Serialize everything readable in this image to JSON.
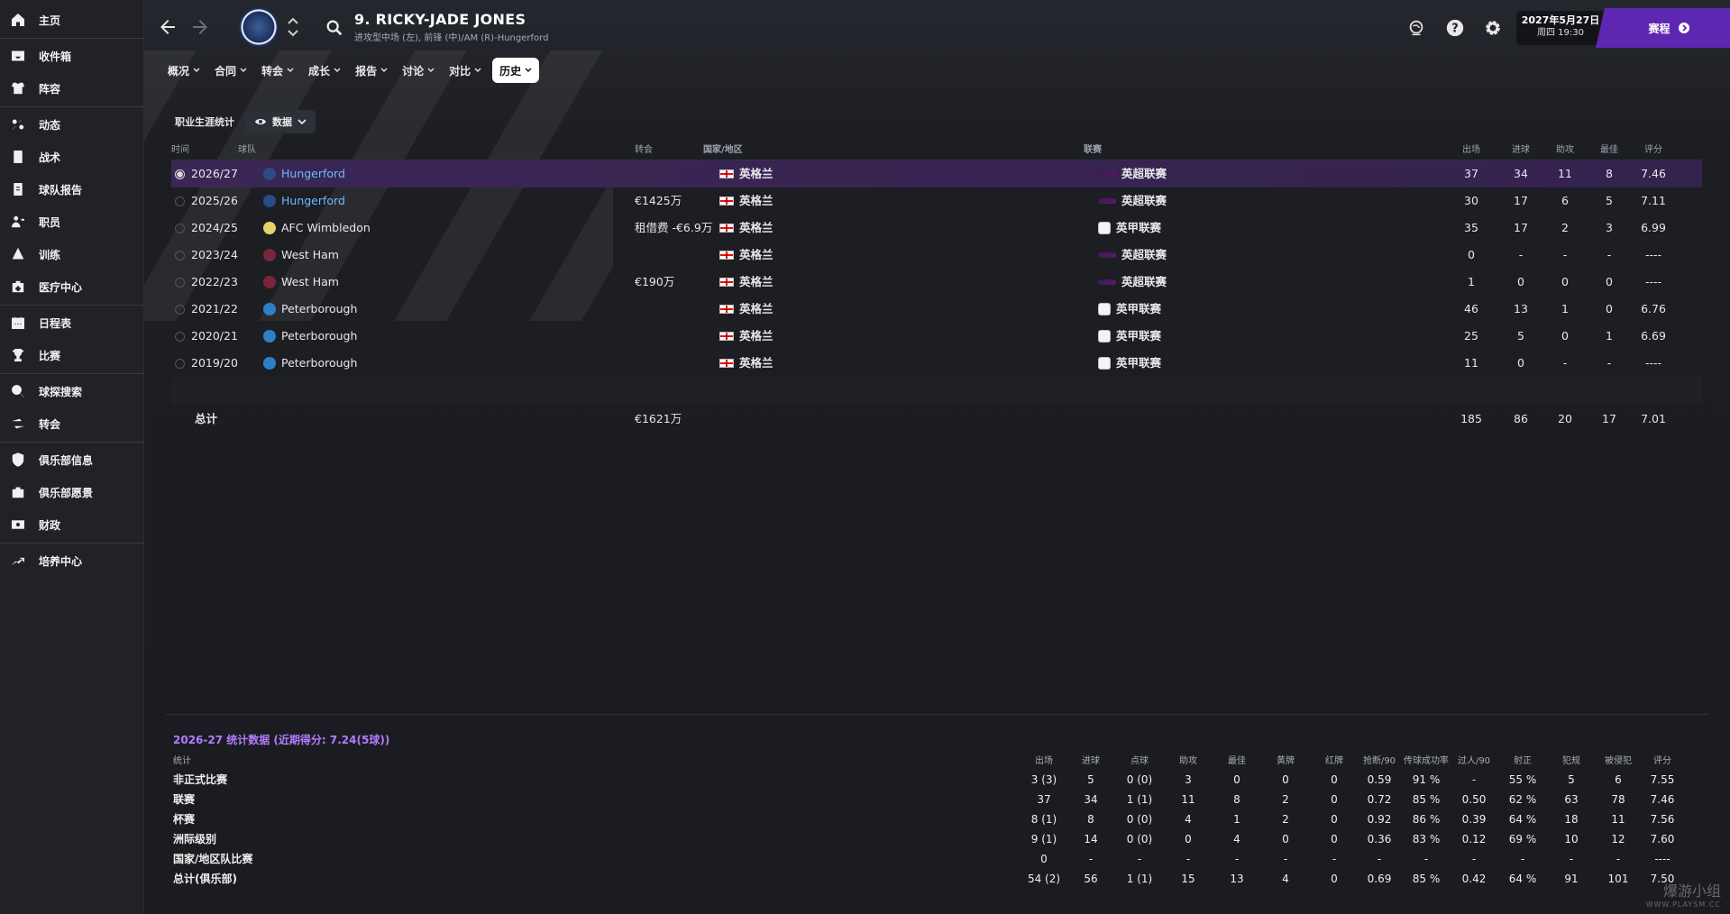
{
  "sidebar": {
    "items": [
      {
        "label": "主页",
        "icon": "home-icon"
      },
      {
        "label": "收件箱",
        "icon": "inbox-icon"
      },
      {
        "label": "阵容",
        "icon": "squad-icon"
      },
      {
        "label": "动态",
        "icon": "dynamics-icon"
      },
      {
        "label": "战术",
        "icon": "tactics-icon"
      },
      {
        "label": "球队报告",
        "icon": "team-report-icon"
      },
      {
        "label": "职员",
        "icon": "staff-icon"
      },
      {
        "label": "训练",
        "icon": "training-icon"
      },
      {
        "label": "医疗中心",
        "icon": "medical-icon"
      },
      {
        "label": "日程表",
        "icon": "schedule-icon"
      },
      {
        "label": "比赛",
        "icon": "trophy-icon"
      },
      {
        "label": "球探搜索",
        "icon": "scouting-icon"
      },
      {
        "label": "转会",
        "icon": "transfer-icon"
      },
      {
        "label": "俱乐部信息",
        "icon": "club-info-icon"
      },
      {
        "label": "俱乐部愿景",
        "icon": "club-vision-icon"
      },
      {
        "label": "财政",
        "icon": "finance-icon"
      },
      {
        "label": "培养中心",
        "icon": "development-icon"
      }
    ]
  },
  "header": {
    "player_name": "9. RICKY-JADE JONES",
    "player_sub": "进攻型中场 (左), 前锋 (中)/AM (R)-Hungerford",
    "date": "2027年5月27日",
    "date_sub": "周四 19:30",
    "continue_label": "赛程"
  },
  "tabs": [
    {
      "label": "概况"
    },
    {
      "label": "合同"
    },
    {
      "label": "转会"
    },
    {
      "label": "成长"
    },
    {
      "label": "报告"
    },
    {
      "label": "讨论"
    },
    {
      "label": "对比"
    },
    {
      "label": "历史",
      "active": true
    }
  ],
  "subheader": {
    "label": "职业生涯统计",
    "data_button": "数据"
  },
  "career": {
    "headers": {
      "year": "时间",
      "team": "球队",
      "fee": "转会",
      "nation": "国家/地区",
      "league": "联赛",
      "apps": "出场",
      "goals": "进球",
      "assists": "助攻",
      "pom": "最佳",
      "rating": "评分"
    },
    "rows": [
      {
        "year": "2026/27",
        "team": "Hungerford",
        "team_color": "#2b4a86",
        "link": true,
        "fee": "",
        "nation": "英格兰",
        "league": "英超联赛",
        "league_type": "pl",
        "apps": "37",
        "goals": "34",
        "assists": "11",
        "pom": "8",
        "rating": "7.46",
        "selected": true
      },
      {
        "year": "2025/26",
        "team": "Hungerford",
        "team_color": "#2b4a86",
        "link": true,
        "fee": "€1425万",
        "nation": "英格兰",
        "league": "英超联赛",
        "league_type": "pl",
        "apps": "30",
        "goals": "17",
        "assists": "6",
        "pom": "5",
        "rating": "7.11"
      },
      {
        "year": "2024/25",
        "team": "AFC Wimbledon",
        "team_color": "#e8d36a",
        "link": false,
        "fee": "租借费 -€6.9万",
        "nation": "英格兰",
        "league": "英甲联赛",
        "league_type": "efl",
        "apps": "35",
        "goals": "17",
        "assists": "2",
        "pom": "3",
        "rating": "6.99"
      },
      {
        "year": "2023/24",
        "team": "West Ham",
        "team_color": "#7a263a",
        "link": false,
        "fee": "",
        "nation": "英格兰",
        "league": "英超联赛",
        "league_type": "pl",
        "apps": "0",
        "goals": "-",
        "assists": "-",
        "pom": "-",
        "rating": "----"
      },
      {
        "year": "2022/23",
        "team": "West Ham",
        "team_color": "#7a263a",
        "link": false,
        "fee": "€190万",
        "nation": "英格兰",
        "league": "英超联赛",
        "league_type": "pl",
        "apps": "1",
        "goals": "0",
        "assists": "0",
        "pom": "0",
        "rating": "----"
      },
      {
        "year": "2021/22",
        "team": "Peterborough",
        "team_color": "#2f7fc8",
        "link": false,
        "fee": "",
        "nation": "英格兰",
        "league": "英甲联赛",
        "league_type": "efl",
        "apps": "46",
        "goals": "13",
        "assists": "1",
        "pom": "0",
        "rating": "6.76"
      },
      {
        "year": "2020/21",
        "team": "Peterborough",
        "team_color": "#2f7fc8",
        "link": false,
        "fee": "",
        "nation": "英格兰",
        "league": "英甲联赛",
        "league_type": "efl",
        "apps": "25",
        "goals": "5",
        "assists": "0",
        "pom": "1",
        "rating": "6.69"
      },
      {
        "year": "2019/20",
        "team": "Peterborough",
        "team_color": "#2f7fc8",
        "link": false,
        "fee": "",
        "nation": "英格兰",
        "league": "英甲联赛",
        "league_type": "efl",
        "apps": "11",
        "goals": "0",
        "assists": "-",
        "pom": "-",
        "rating": "----"
      }
    ],
    "totals": {
      "label": "总计",
      "fee": "€1621万",
      "apps": "185",
      "goals": "86",
      "assists": "20",
      "pom": "17",
      "rating": "7.01"
    }
  },
  "season": {
    "title": "2026-27 统计数据 (近期得分: 7.24(5球))",
    "headers": [
      "统计",
      "出场",
      "进球",
      "点球",
      "助攻",
      "最佳",
      "黄牌",
      "红牌",
      "抢断/90",
      "传球成功率",
      "过人/90",
      "射正",
      "犯规",
      "被侵犯",
      "评分"
    ],
    "rows": [
      [
        "非正式比赛",
        "3 (3)",
        "5",
        "0 (0)",
        "3",
        "0",
        "0",
        "0",
        "0.59",
        "91 %",
        "-",
        "55 %",
        "5",
        "6",
        "7.55"
      ],
      [
        "联赛",
        "37",
        "34",
        "1 (1)",
        "11",
        "8",
        "2",
        "0",
        "0.72",
        "85 %",
        "0.50",
        "62 %",
        "63",
        "78",
        "7.46"
      ],
      [
        "杯赛",
        "8 (1)",
        "8",
        "0 (0)",
        "4",
        "1",
        "2",
        "0",
        "0.92",
        "86 %",
        "0.39",
        "64 %",
        "18",
        "11",
        "7.56"
      ],
      [
        "洲际级别",
        "9 (1)",
        "14",
        "0 (0)",
        "0",
        "4",
        "0",
        "0",
        "0.36",
        "83 %",
        "0.12",
        "69 %",
        "10",
        "12",
        "7.60"
      ],
      [
        "国家/地区队比赛",
        "0",
        "-",
        "-",
        "-",
        "-",
        "-",
        "-",
        "-",
        "-",
        "-",
        "-",
        "-",
        "-",
        "----"
      ],
      [
        "总计(俱乐部)",
        "54 (2)",
        "56",
        "1 (1)",
        "15",
        "13",
        "4",
        "0",
        "0.69",
        "85 %",
        "0.42",
        "64 %",
        "91",
        "101",
        "7.50"
      ]
    ]
  },
  "watermark": {
    "text": "爆游小组",
    "sub": "WWW.PLAYSM.CC"
  },
  "colors": {
    "accent": "#5e27b2",
    "link": "#6bb9ff",
    "season_title": "#b27cff"
  }
}
